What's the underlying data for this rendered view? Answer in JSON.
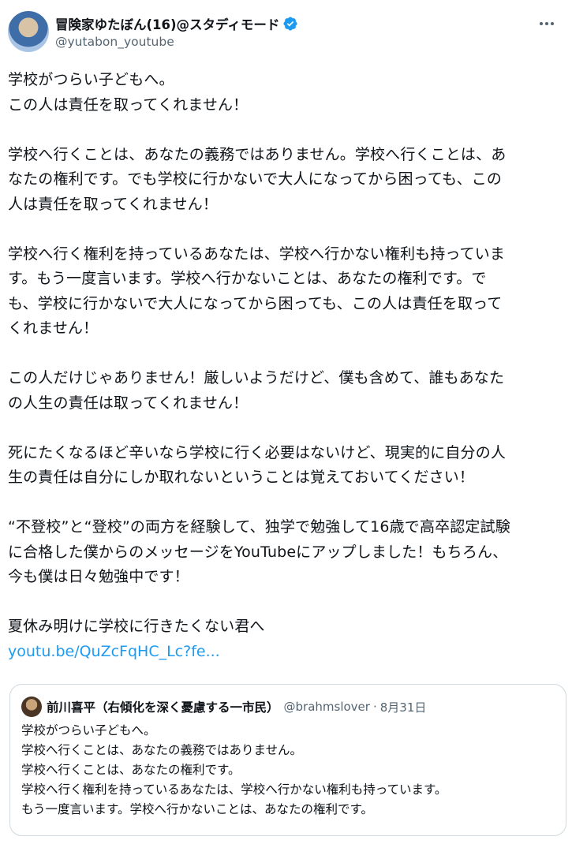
{
  "author": {
    "display_name": "冒険家ゆたぼん(16)@スタディモード",
    "handle": "@yutabon_youtube",
    "verified": true
  },
  "tweet": {
    "paragraphs": [
      "学校がつらい子どもへ。\nこの人は責任を取ってくれません！",
      "学校へ行くことは、あなたの義務ではありません。学校へ行くことは、あ\nなたの権利です。でも学校に行かないで大人になってから困っても、この\n人は責任を取ってくれません！",
      "学校へ行く権利を持っているあなたは、学校へ行かない権利も持っていま\nす。もう一度言います。学校へ行かないことは、あなたの権利です。で\nも、学校に行かないで大人になってから困っても、この人は責任を取って\nくれません！",
      "この人だけじゃありません！厳しいようだけど、僕も含めて、誰もあなた\nの人生の責任は取ってくれません！",
      "死にたくなるほど辛いなら学校に行く必要はないけど、現実的に自分の人\n生の責任は自分にしか取れないということは覚えておいてください！",
      "“不登校”と“登校”の両方を経験して、独学で勉強して16歳で高卒認定試験\nに合格した僕からのメッセージをYouTubeにアップしました！もちろん、\n今も僕は日々勉強中です！",
      "夏休み明けに学校に行きたくない君へ"
    ],
    "link": "youtu.be/QuZcFqHC_Lc?fe..."
  },
  "quoted": {
    "display_name": "前川喜平（右傾化を深く憂慮する一市民）",
    "handle": "@brahmslover",
    "separator": "·",
    "date": "8月31日",
    "text": "学校がつらい子どもへ。\n学校へ行くことは、あなたの義務ではありません。\n学校へ行くことは、あなたの権利です。\n学校へ行く権利を持っているあなたは、学校へ行かない権利も持っています。\nもう一度言います。学校へ行かないことは、あなたの権利です。"
  },
  "icons": {
    "verified": "verified-badge-icon",
    "more": "more-options-icon"
  },
  "colors": {
    "accent": "#1d9bf0",
    "secondary_text": "#536471",
    "border": "#cfd9de"
  }
}
